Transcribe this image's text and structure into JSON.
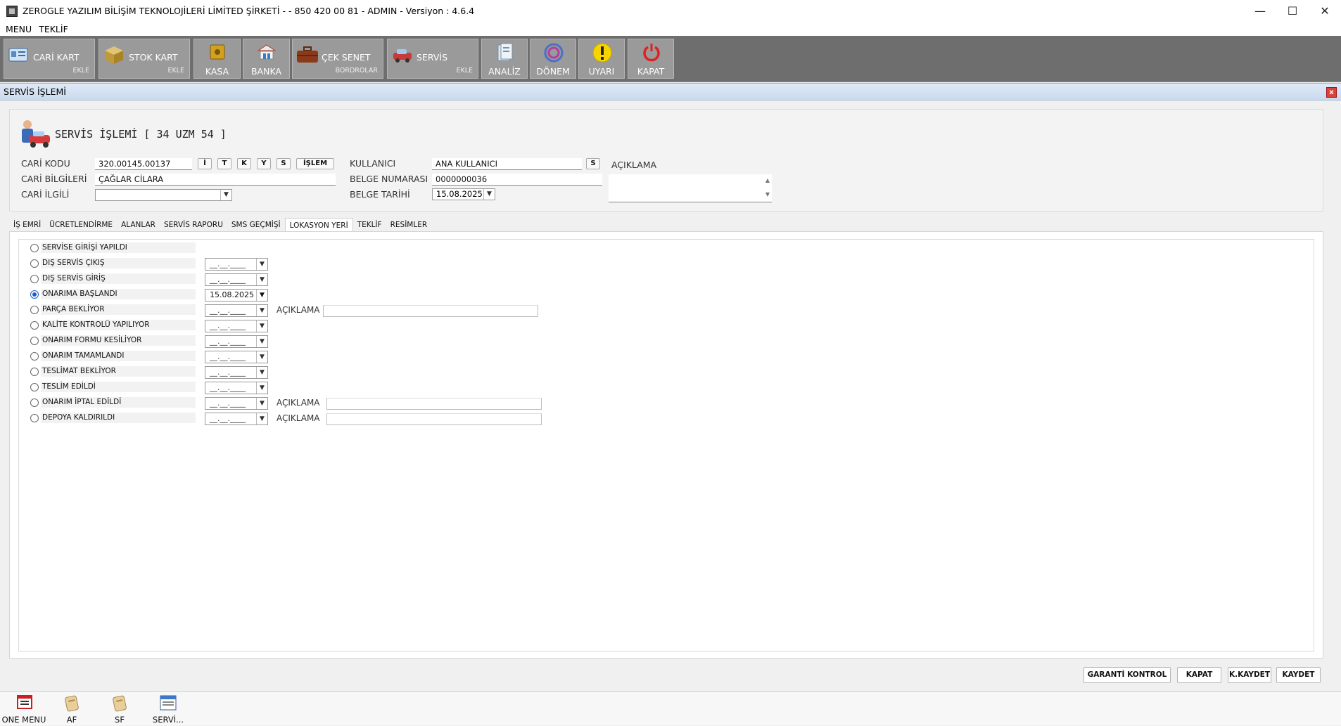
{
  "window": {
    "title": "ZEROGLE YAZILIM BİLİŞİM TEKNOLOJİLERİ LİMİTED ŞİRKETİ -  - 850 420 00 81 - ADMIN -  Versiyon : 4.6.4",
    "minimize": "—",
    "maximize": "☐",
    "close": "✕"
  },
  "menu": [
    "MENU",
    "TEKLİF"
  ],
  "toolbar": {
    "cari_kart": {
      "label": "CARİ KART",
      "sub": "EKLE"
    },
    "stok_kart": {
      "label": "STOK KART",
      "sub": "EKLE"
    },
    "kasa": "KASA",
    "banka": "BANKA",
    "cek_senet": {
      "label": "ÇEK SENET",
      "sub": "BORDROLAR"
    },
    "servis": {
      "label": "SERVİS",
      "sub": "EKLE"
    },
    "analiz": "ANALİZ",
    "donem": "DÖNEM",
    "uyari": "UYARI",
    "kapat": "KAPAT"
  },
  "form_window": {
    "title": "SERVİS İŞLEMİ",
    "close": "x"
  },
  "header": {
    "title": "SERVİS İŞLEMİ [ 34 UZM 54 ]",
    "cari_kodu_label": "CARİ KODU",
    "cari_kodu": "320.00145.00137",
    "cari_bilgileri_label": "CARİ BİLGİLERİ",
    "cari_bilgileri": "ÇAĞLAR CİLARA",
    "cari_ilgili_label": "CARİ İLGİLİ",
    "cari_ilgili": "",
    "btn_i": "İ",
    "btn_t": "T",
    "btn_k": "K",
    "btn_y": "Y",
    "btn_s": "S",
    "btn_islem": "İŞLEM",
    "kullanici_label": "KULLANICI",
    "kullanici": "ANA KULLANICI",
    "kullanici_btn": "S",
    "belge_no_label": "BELGE NUMARASI",
    "belge_no": "0000000036",
    "belge_tarihi_label": "BELGE TARİHİ",
    "belge_tarihi": "15.08.2025",
    "aciklama_label": "AÇIKLAMA",
    "aciklama": ""
  },
  "tabs": [
    {
      "label": "İŞ EMRİ",
      "active": false
    },
    {
      "label": "ÜCRETLENDİRME",
      "active": false
    },
    {
      "label": "ALANLAR",
      "active": false
    },
    {
      "label": "SERVİS RAPORU",
      "active": false
    },
    {
      "label": "SMS GEÇMİŞİ",
      "active": false
    },
    {
      "label": "LOKASYON YERİ",
      "active": true
    },
    {
      "label": "TEKLİF",
      "active": false
    },
    {
      "label": "RESİMLER",
      "active": false
    }
  ],
  "locations": {
    "empty_date": "__.__.____",
    "aciklama_label": "AÇIKLAMA",
    "rows": [
      {
        "label": "SERVİSE GİRİŞİ YAPILDI",
        "selected": false
      },
      {
        "label": "DIŞ SERVİS ÇIKIŞ",
        "selected": false
      },
      {
        "label": "DIŞ SERVİS GİRİŞ",
        "selected": false
      },
      {
        "label": "ONARIMA BAŞLANDI",
        "selected": true,
        "date": "15.08.2025"
      },
      {
        "label": "PARÇA BEKLİYOR",
        "selected": false
      },
      {
        "label": "KALİTE KONTROLÜ YAPILIYOR",
        "selected": false
      },
      {
        "label": "ONARIM FORMU KESİLİYOR",
        "selected": false
      },
      {
        "label": "ONARIM TAMAMLANDI",
        "selected": false
      },
      {
        "label": "TESLİMAT BEKLİYOR",
        "selected": false
      },
      {
        "label": "TESLİM EDİLDİ",
        "selected": false
      },
      {
        "label": "ONARIM İPTAL EDİLDİ",
        "selected": false
      },
      {
        "label": "DEPOYA KALDIRILDI",
        "selected": false
      }
    ]
  },
  "buttons": {
    "garanti": "GARANTİ KONTROL",
    "kapat": "KAPAT",
    "kkaydet": "K.KAYDET",
    "kaydet": "KAYDET"
  },
  "taskbar": [
    "ONE MENU",
    "AF",
    "SF",
    "SERVİ..."
  ],
  "icons": {
    "window_controls": [
      "minimize-icon",
      "maximize-icon",
      "close-icon"
    ],
    "toolbar": [
      "id-card-icon",
      "box-icon",
      "safe-icon",
      "bank-icon",
      "briefcase-icon",
      "car-service-icon",
      "analysis-icon",
      "period-icon",
      "warning-icon",
      "power-icon"
    ],
    "combo": "chevron-down-icon"
  }
}
